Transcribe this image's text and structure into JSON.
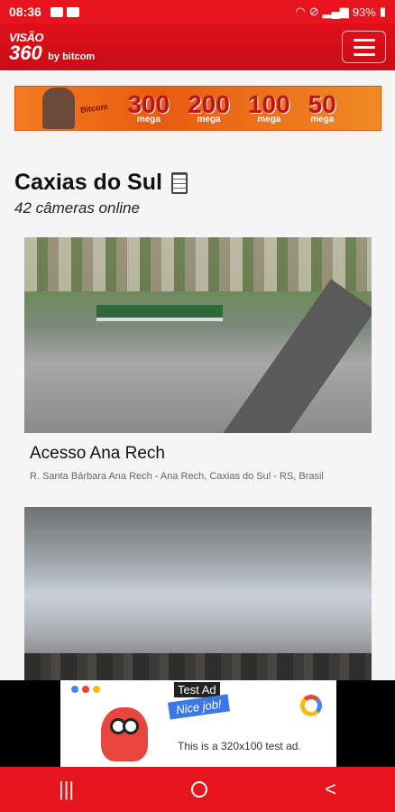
{
  "status_bar": {
    "time": "08:36",
    "battery": "93%"
  },
  "header": {
    "logo_line1": "VISÃO",
    "logo_line2": "360",
    "logo_by": "by bitcom"
  },
  "banner": {
    "brand": "Bitcom",
    "speeds": [
      {
        "value": "300",
        "unit": "mega"
      },
      {
        "value": "200",
        "unit": "mega"
      },
      {
        "value": "100",
        "unit": "mega"
      },
      {
        "value": "50",
        "unit": "mega"
      }
    ]
  },
  "section": {
    "title": "Caxias do Sul",
    "subtitle": "42 câmeras online"
  },
  "cameras": [
    {
      "title": "Acesso Ana Rech",
      "address": "R. Santa Bárbara Ana Rech - Ana Rech, Caxias do Sul - RS, Brasil"
    },
    {
      "title": "",
      "address": ""
    }
  ],
  "ad": {
    "label": "Test Ad",
    "badge": "Nice job!",
    "text": "This is a 320x100 test ad."
  },
  "nav": {
    "recent": "|||",
    "back": "<"
  }
}
